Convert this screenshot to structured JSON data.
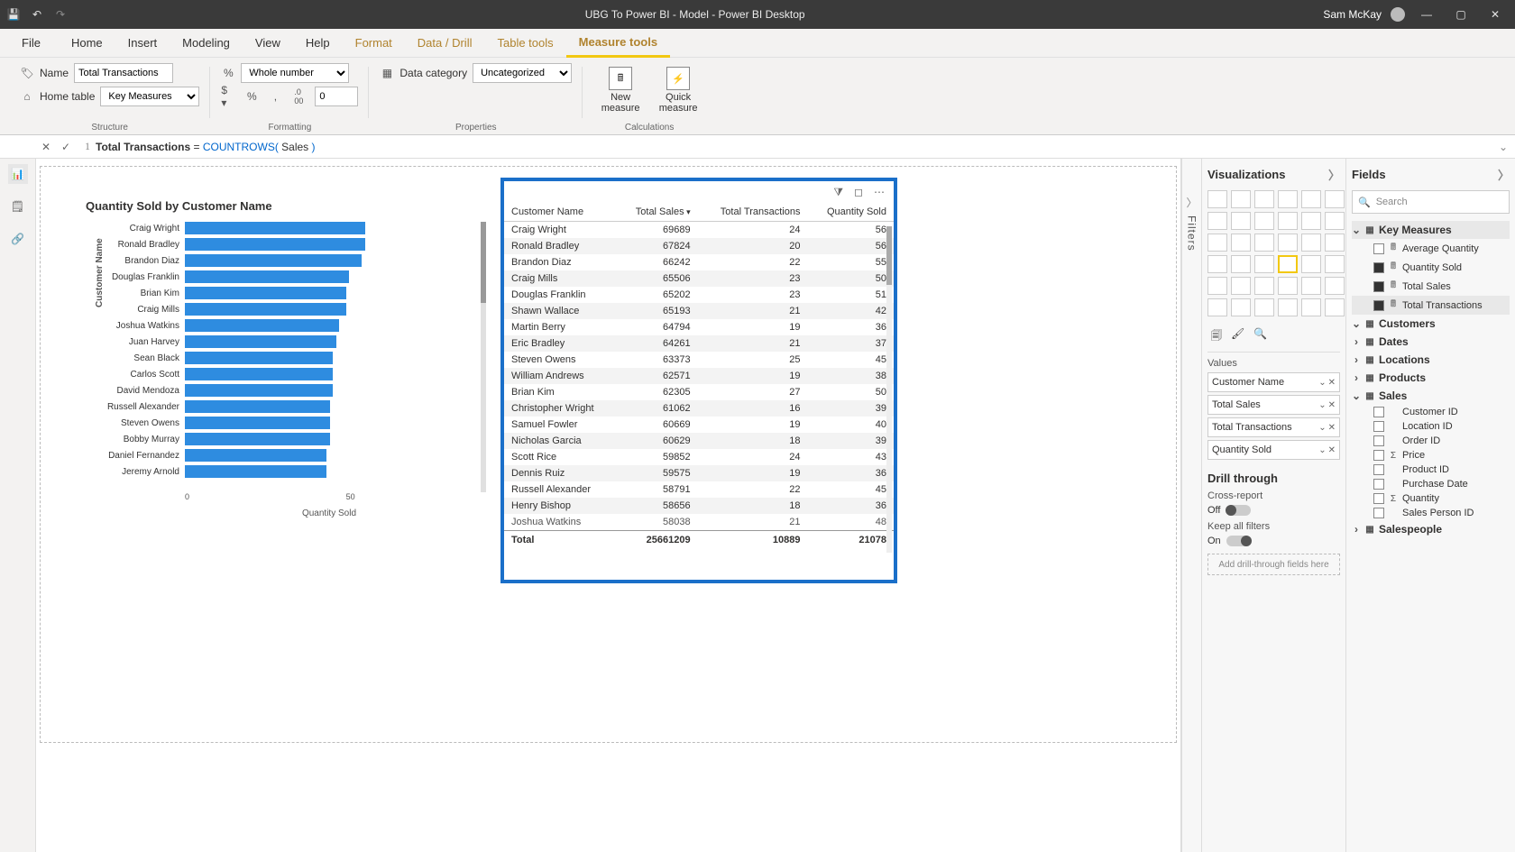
{
  "titlebar": {
    "title": "UBG To Power BI - Model - Power BI Desktop",
    "user": "Sam McKay"
  },
  "ribbon": {
    "tabs": [
      "File",
      "Home",
      "Insert",
      "Modeling",
      "View",
      "Help",
      "Format",
      "Data / Drill",
      "Table tools",
      "Measure tools"
    ],
    "active": "Measure tools",
    "name_label": "Name",
    "name_value": "Total Transactions",
    "home_table_label": "Home table",
    "home_table_value": "Key Measures",
    "format_value": "Whole number",
    "decimals": "0",
    "data_category_label": "Data category",
    "data_category_value": "Uncategorized",
    "new_measure": "New measure",
    "quick_measure": "Quick measure",
    "group_structure": "Structure",
    "group_formatting": "Formatting",
    "group_properties": "Properties",
    "group_calculations": "Calculations"
  },
  "formula": {
    "line": "1",
    "measure": "Total Transactions",
    "eq": " = ",
    "func": "COUNTROWS(",
    "arg": " Sales ",
    "close": ")"
  },
  "filters_label": "Filters",
  "viz": {
    "header": "Visualizations",
    "values_label": "Values",
    "wells": [
      "Customer Name",
      "Total Sales",
      "Total Transactions",
      "Quantity Sold"
    ],
    "drill_header": "Drill through",
    "cross_report": "Cross-report",
    "off": "Off",
    "keep_filters": "Keep all filters",
    "on": "On",
    "drill_placeholder": "Add drill-through fields here"
  },
  "fields": {
    "header": "Fields",
    "search": "Search",
    "tables": [
      {
        "name": "Key Measures",
        "expanded": true,
        "icon": "measure-table",
        "fields": [
          {
            "name": "Average Quantity",
            "checked": false,
            "type": "measure"
          },
          {
            "name": "Quantity Sold",
            "checked": true,
            "type": "measure"
          },
          {
            "name": "Total Sales",
            "checked": true,
            "type": "measure"
          },
          {
            "name": "Total Transactions",
            "checked": true,
            "type": "measure",
            "selected": true
          }
        ]
      },
      {
        "name": "Customers",
        "expanded": true,
        "icon": "table",
        "fields": []
      },
      {
        "name": "Dates",
        "expanded": false,
        "icon": "table"
      },
      {
        "name": "Locations",
        "expanded": false,
        "icon": "table"
      },
      {
        "name": "Products",
        "expanded": false,
        "icon": "table"
      },
      {
        "name": "Sales",
        "expanded": true,
        "icon": "table",
        "fields": [
          {
            "name": "Customer ID",
            "checked": false,
            "type": "col"
          },
          {
            "name": "Location ID",
            "checked": false,
            "type": "col"
          },
          {
            "name": "Order ID",
            "checked": false,
            "type": "col"
          },
          {
            "name": "Price",
            "checked": false,
            "type": "sum"
          },
          {
            "name": "Product ID",
            "checked": false,
            "type": "col"
          },
          {
            "name": "Purchase Date",
            "checked": false,
            "type": "col"
          },
          {
            "name": "Quantity",
            "checked": false,
            "type": "sum"
          },
          {
            "name": "Sales Person ID",
            "checked": false,
            "type": "col"
          }
        ]
      },
      {
        "name": "Salespeople",
        "expanded": false,
        "icon": "table"
      }
    ]
  },
  "chart_data": {
    "type": "bar",
    "title": "Quantity Sold by Customer Name",
    "ylabel": "Customer Name",
    "xlabel": "Quantity Sold",
    "xlim": [
      0,
      56
    ],
    "xticks": [
      0,
      50
    ],
    "categories": [
      "Craig Wright",
      "Ronald Bradley",
      "Brandon Diaz",
      "Douglas Franklin",
      "Brian Kim",
      "Craig Mills",
      "Joshua Watkins",
      "Juan Harvey",
      "Sean Black",
      "Carlos Scott",
      "David Mendoza",
      "Russell Alexander",
      "Steven Owens",
      "Bobby Murray",
      "Daniel Fernandez",
      "Jeremy Arnold"
    ],
    "values": [
      56,
      56,
      55,
      51,
      50,
      50,
      48,
      47,
      46,
      46,
      46,
      45,
      45,
      45,
      44,
      44
    ]
  },
  "table": {
    "columns": [
      "Customer Name",
      "Total Sales",
      "Total Transactions",
      "Quantity Sold"
    ],
    "sort_col": "Total Sales",
    "rows": [
      [
        "Craig Wright",
        "69689",
        "24",
        "56"
      ],
      [
        "Ronald Bradley",
        "67824",
        "20",
        "56"
      ],
      [
        "Brandon Diaz",
        "66242",
        "22",
        "55"
      ],
      [
        "Craig Mills",
        "65506",
        "23",
        "50"
      ],
      [
        "Douglas Franklin",
        "65202",
        "23",
        "51"
      ],
      [
        "Shawn Wallace",
        "65193",
        "21",
        "42"
      ],
      [
        "Martin Berry",
        "64794",
        "19",
        "36"
      ],
      [
        "Eric Bradley",
        "64261",
        "21",
        "37"
      ],
      [
        "Steven Owens",
        "63373",
        "25",
        "45"
      ],
      [
        "William Andrews",
        "62571",
        "19",
        "38"
      ],
      [
        "Brian Kim",
        "62305",
        "27",
        "50"
      ],
      [
        "Christopher Wright",
        "61062",
        "16",
        "39"
      ],
      [
        "Samuel Fowler",
        "60669",
        "19",
        "40"
      ],
      [
        "Nicholas Garcia",
        "60629",
        "18",
        "39"
      ],
      [
        "Scott Rice",
        "59852",
        "24",
        "43"
      ],
      [
        "Dennis Ruiz",
        "59575",
        "19",
        "36"
      ],
      [
        "Russell Alexander",
        "58791",
        "22",
        "45"
      ],
      [
        "Henry Bishop",
        "58656",
        "18",
        "36"
      ]
    ],
    "overflow_row": [
      "Joshua Watkins",
      "58038",
      "21",
      "48"
    ],
    "total_label": "Total",
    "totals": [
      "25661209",
      "10889",
      "21078"
    ]
  }
}
